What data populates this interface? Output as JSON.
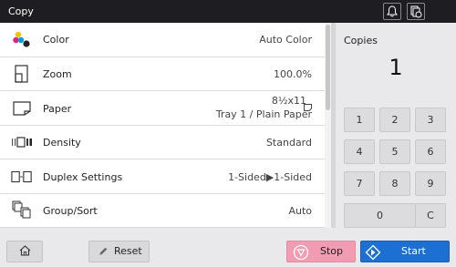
{
  "header": {
    "title": "Copy",
    "icons": [
      "bell-icon",
      "job-status-icon"
    ]
  },
  "settings": [
    {
      "label": "Color",
      "value": "Auto Color",
      "icon": "color-dots-icon"
    },
    {
      "label": "Zoom",
      "value": "100.0%",
      "icon": "zoom-page-icon"
    },
    {
      "label": "Paper",
      "value": "8½x11",
      "value2": "Tray 1 / Plain Paper",
      "icon": "paper-icon"
    },
    {
      "label": "Density",
      "value": "Standard",
      "icon": "density-icon"
    },
    {
      "label": "Duplex Settings",
      "value": "1-Sided▶1-Sided",
      "icon": "duplex-icon"
    },
    {
      "label": "Group/Sort",
      "value": "Auto",
      "icon": "group-sort-icon"
    }
  ],
  "copies": {
    "label": "Copies",
    "value": "1"
  },
  "keypad": [
    "1",
    "2",
    "3",
    "4",
    "5",
    "6",
    "7",
    "8",
    "9",
    "0",
    "C"
  ],
  "buttons": {
    "home_icon": "home-icon",
    "reset": "Reset",
    "stop": "Stop",
    "start": "Start"
  },
  "colors": {
    "titlebar": "#1e1e22",
    "stop": "#f29cb3",
    "start": "#1c6fd3"
  }
}
